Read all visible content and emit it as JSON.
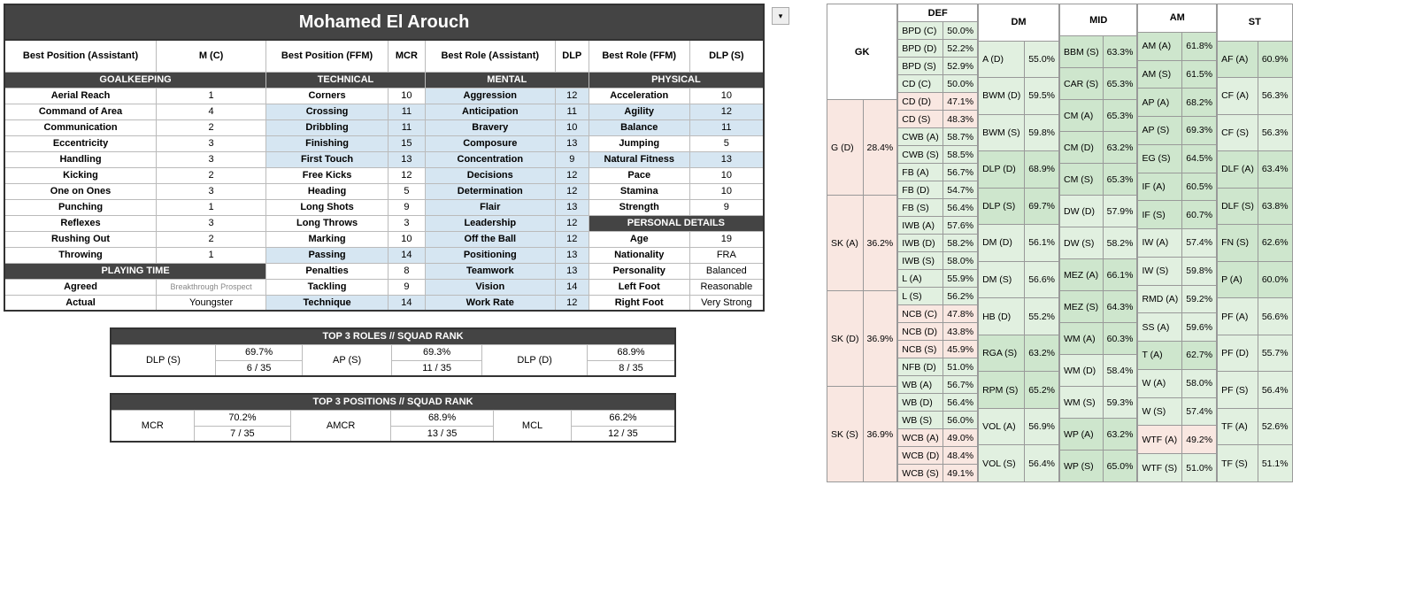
{
  "player_name": "Mohamed El Arouch",
  "best": {
    "pos_assistant": {
      "label": "Best Position (Assistant)",
      "value": "M (C)"
    },
    "pos_ffm": {
      "label": "Best Position (FFM)",
      "value": "MCR"
    },
    "role_assistant": {
      "label": "Best Role (Assistant)",
      "value": "DLP"
    },
    "role_ffm": {
      "label": "Best Role (FFM)",
      "value": "DLP (S)"
    }
  },
  "sections": {
    "goalkeeping": "GOALKEEPING",
    "technical": "TECHNICAL",
    "mental": "MENTAL",
    "physical": "PHYSICAL",
    "playing_time": "PLAYING TIME",
    "personal": "PERSONAL DETAILS"
  },
  "gk": [
    {
      "n": "Aerial Reach",
      "v": "1"
    },
    {
      "n": "Command of Area",
      "v": "4"
    },
    {
      "n": "Communication",
      "v": "2"
    },
    {
      "n": "Eccentricity",
      "v": "3"
    },
    {
      "n": "Handling",
      "v": "3"
    },
    {
      "n": "Kicking",
      "v": "2"
    },
    {
      "n": "One on Ones",
      "v": "3"
    },
    {
      "n": "Punching",
      "v": "1"
    },
    {
      "n": "Reflexes",
      "v": "3"
    },
    {
      "n": "Rushing Out",
      "v": "2"
    },
    {
      "n": "Throwing",
      "v": "1"
    }
  ],
  "tech": [
    {
      "n": "Corners",
      "v": "10"
    },
    {
      "n": "Crossing",
      "v": "11",
      "hl": 1
    },
    {
      "n": "Dribbling",
      "v": "11",
      "hl": 1
    },
    {
      "n": "Finishing",
      "v": "15",
      "hl": 1
    },
    {
      "n": "First Touch",
      "v": "13",
      "hl": 1
    },
    {
      "n": "Free Kicks",
      "v": "12"
    },
    {
      "n": "Heading",
      "v": "5"
    },
    {
      "n": "Long Shots",
      "v": "9"
    },
    {
      "n": "Long Throws",
      "v": "3"
    },
    {
      "n": "Marking",
      "v": "10"
    },
    {
      "n": "Passing",
      "v": "14",
      "hl": 1
    },
    {
      "n": "Penalties",
      "v": "8"
    },
    {
      "n": "Tackling",
      "v": "9"
    },
    {
      "n": "Technique",
      "v": "14",
      "hl": 1
    }
  ],
  "mental": [
    {
      "n": "Aggression",
      "v": "12",
      "hl": 1
    },
    {
      "n": "Anticipation",
      "v": "11",
      "hl": 1
    },
    {
      "n": "Bravery",
      "v": "10",
      "hl": 1
    },
    {
      "n": "Composure",
      "v": "13",
      "hl": 1
    },
    {
      "n": "Concentration",
      "v": "9",
      "hl": 1
    },
    {
      "n": "Decisions",
      "v": "12",
      "hl": 1
    },
    {
      "n": "Determination",
      "v": "12",
      "hl": 1
    },
    {
      "n": "Flair",
      "v": "13",
      "hl": 1
    },
    {
      "n": "Leadership",
      "v": "12",
      "hl": 1
    },
    {
      "n": "Off the Ball",
      "v": "12",
      "hl": 1
    },
    {
      "n": "Positioning",
      "v": "13",
      "hl": 1
    },
    {
      "n": "Teamwork",
      "v": "13",
      "hl": 1
    },
    {
      "n": "Vision",
      "v": "14",
      "hl": 1
    },
    {
      "n": "Work Rate",
      "v": "12",
      "hl": 1
    }
  ],
  "phys": [
    {
      "n": "Acceleration",
      "v": "10"
    },
    {
      "n": "Agility",
      "v": "12",
      "hl": 1
    },
    {
      "n": "Balance",
      "v": "11",
      "hl": 1
    },
    {
      "n": "Jumping",
      "v": "5"
    },
    {
      "n": "Natural Fitness",
      "v": "13",
      "hl": 1
    },
    {
      "n": "Pace",
      "v": "10"
    },
    {
      "n": "Stamina",
      "v": "10"
    },
    {
      "n": "Strength",
      "v": "9"
    }
  ],
  "playing_time": {
    "agreed": {
      "label": "Agreed",
      "value": "Breakthrough Prospect"
    },
    "actual": {
      "label": "Actual",
      "value": "Youngster"
    }
  },
  "personal": [
    {
      "n": "Age",
      "v": "19"
    },
    {
      "n": "Nationality",
      "v": "FRA"
    },
    {
      "n": "Personality",
      "v": "Balanced"
    },
    {
      "n": "Left Foot",
      "v": "Reasonable"
    },
    {
      "n": "Right Foot",
      "v": "Very Strong"
    }
  ],
  "top3roles": {
    "title": "TOP 3 ROLES // SQUAD RANK",
    "items": [
      {
        "role": "DLP (S)",
        "pct": "69.7%",
        "rank": "6 / 35"
      },
      {
        "role": "AP (S)",
        "pct": "69.3%",
        "rank": "11 / 35"
      },
      {
        "role": "DLP (D)",
        "pct": "68.9%",
        "rank": "8 / 35"
      }
    ]
  },
  "top3pos": {
    "title": "TOP 3 POSITIONS // SQUAD RANK",
    "items": [
      {
        "role": "MCR",
        "pct": "70.2%",
        "rank": "7 / 35"
      },
      {
        "role": "AMCR",
        "pct": "68.9%",
        "rank": "13 / 35"
      },
      {
        "role": "MCL",
        "pct": "66.2%",
        "rank": "12 / 35"
      }
    ]
  },
  "rolecols": [
    {
      "hdr": "GK",
      "rows": [
        {
          "n": "G (D)",
          "v": "28.4%",
          "c": "pale-red"
        },
        {
          "n": "SK (A)",
          "v": "36.2%",
          "c": "pale-red"
        },
        {
          "n": "SK (D)",
          "v": "36.9%",
          "c": "pale-red"
        },
        {
          "n": "SK (S)",
          "v": "36.9%",
          "c": "pale-red"
        }
      ]
    },
    {
      "hdr": "DEF",
      "rows": [
        {
          "n": "BPD (C)",
          "v": "50.0%",
          "c": "pale-green"
        },
        {
          "n": "BPD (D)",
          "v": "52.2%",
          "c": "pale-green"
        },
        {
          "n": "BPD (S)",
          "v": "52.9%",
          "c": "pale-green"
        },
        {
          "n": "CD (C)",
          "v": "50.0%",
          "c": "pale-green"
        },
        {
          "n": "CD (D)",
          "v": "47.1%",
          "c": "pale-red"
        },
        {
          "n": "CD (S)",
          "v": "48.3%",
          "c": "pale-red"
        },
        {
          "n": "CWB (A)",
          "v": "58.7%",
          "c": "pale-green"
        },
        {
          "n": "CWB (S)",
          "v": "58.5%",
          "c": "pale-green"
        },
        {
          "n": "FB (A)",
          "v": "56.7%",
          "c": "pale-green"
        },
        {
          "n": "FB (D)",
          "v": "54.7%",
          "c": "pale-green"
        },
        {
          "n": "FB (S)",
          "v": "56.4%",
          "c": "pale-green"
        },
        {
          "n": "IWB (A)",
          "v": "57.6%",
          "c": "pale-green"
        },
        {
          "n": "IWB (D)",
          "v": "58.2%",
          "c": "pale-green"
        },
        {
          "n": "IWB (S)",
          "v": "58.0%",
          "c": "pale-green"
        },
        {
          "n": "L (A)",
          "v": "55.9%",
          "c": "pale-green"
        },
        {
          "n": "L (S)",
          "v": "56.2%",
          "c": "pale-green"
        },
        {
          "n": "NCB (C)",
          "v": "47.8%",
          "c": "pale-red"
        },
        {
          "n": "NCB (D)",
          "v": "43.8%",
          "c": "pale-red"
        },
        {
          "n": "NCB (S)",
          "v": "45.9%",
          "c": "pale-red"
        },
        {
          "n": "NFB (D)",
          "v": "51.0%",
          "c": "pale-green"
        },
        {
          "n": "WB (A)",
          "v": "56.7%",
          "c": "pale-green"
        },
        {
          "n": "WB (D)",
          "v": "56.4%",
          "c": "pale-green"
        },
        {
          "n": "WB (S)",
          "v": "56.0%",
          "c": "pale-green"
        },
        {
          "n": "WCB (A)",
          "v": "49.0%",
          "c": "pale-red"
        },
        {
          "n": "WCB (D)",
          "v": "48.4%",
          "c": "pale-red"
        },
        {
          "n": "WCB (S)",
          "v": "49.1%",
          "c": "pale-red"
        }
      ]
    },
    {
      "hdr": "DM",
      "rows": [
        {
          "n": "A (D)",
          "v": "55.0%",
          "c": "pale-green"
        },
        {
          "n": "BWM (D)",
          "v": "59.5%",
          "c": "pale-green"
        },
        {
          "n": "BWM (S)",
          "v": "59.8%",
          "c": "pale-green"
        },
        {
          "n": "DLP (D)",
          "v": "68.9%",
          "c": "green"
        },
        {
          "n": "DLP (S)",
          "v": "69.7%",
          "c": "green"
        },
        {
          "n": "DM (D)",
          "v": "56.1%",
          "c": "pale-green"
        },
        {
          "n": "DM (S)",
          "v": "56.6%",
          "c": "pale-green"
        },
        {
          "n": "HB (D)",
          "v": "55.2%",
          "c": "pale-green"
        },
        {
          "n": "RGA (S)",
          "v": "63.2%",
          "c": "green"
        },
        {
          "n": "RPM (S)",
          "v": "65.2%",
          "c": "green"
        },
        {
          "n": "VOL (A)",
          "v": "56.9%",
          "c": "pale-green"
        },
        {
          "n": "VOL (S)",
          "v": "56.4%",
          "c": "pale-green"
        }
      ]
    },
    {
      "hdr": "MID",
      "rows": [
        {
          "n": "BBM (S)",
          "v": "63.3%",
          "c": "green"
        },
        {
          "n": "CAR (S)",
          "v": "65.3%",
          "c": "green"
        },
        {
          "n": "CM (A)",
          "v": "65.3%",
          "c": "green"
        },
        {
          "n": "CM (D)",
          "v": "63.2%",
          "c": "green"
        },
        {
          "n": "CM (S)",
          "v": "65.3%",
          "c": "green"
        },
        {
          "n": "DW (D)",
          "v": "57.9%",
          "c": "pale-green"
        },
        {
          "n": "DW (S)",
          "v": "58.2%",
          "c": "pale-green"
        },
        {
          "n": "MEZ (A)",
          "v": "66.1%",
          "c": "green"
        },
        {
          "n": "MEZ (S)",
          "v": "64.3%",
          "c": "green"
        },
        {
          "n": "WM (A)",
          "v": "60.3%",
          "c": "green"
        },
        {
          "n": "WM (D)",
          "v": "58.4%",
          "c": "pale-green"
        },
        {
          "n": "WM (S)",
          "v": "59.3%",
          "c": "pale-green"
        },
        {
          "n": "WP (A)",
          "v": "63.2%",
          "c": "green"
        },
        {
          "n": "WP (S)",
          "v": "65.0%",
          "c": "green"
        }
      ]
    },
    {
      "hdr": "AM",
      "rows": [
        {
          "n": "AM (A)",
          "v": "61.8%",
          "c": "green"
        },
        {
          "n": "AM (S)",
          "v": "61.5%",
          "c": "green"
        },
        {
          "n": "AP (A)",
          "v": "68.2%",
          "c": "green"
        },
        {
          "n": "AP (S)",
          "v": "69.3%",
          "c": "green"
        },
        {
          "n": "EG (S)",
          "v": "64.5%",
          "c": "green"
        },
        {
          "n": "IF (A)",
          "v": "60.5%",
          "c": "green"
        },
        {
          "n": "IF (S)",
          "v": "60.7%",
          "c": "green"
        },
        {
          "n": "IW (A)",
          "v": "57.4%",
          "c": "pale-green"
        },
        {
          "n": "IW (S)",
          "v": "59.8%",
          "c": "pale-green"
        },
        {
          "n": "RMD (A)",
          "v": "59.2%",
          "c": "pale-green"
        },
        {
          "n": "SS (A)",
          "v": "59.6%",
          "c": "pale-green"
        },
        {
          "n": "T (A)",
          "v": "62.7%",
          "c": "green"
        },
        {
          "n": "W (A)",
          "v": "58.0%",
          "c": "pale-green"
        },
        {
          "n": "W (S)",
          "v": "57.4%",
          "c": "pale-green"
        },
        {
          "n": "WTF (A)",
          "v": "49.2%",
          "c": "pale-red"
        },
        {
          "n": "WTF (S)",
          "v": "51.0%",
          "c": "pale-green"
        }
      ]
    },
    {
      "hdr": "ST",
      "rows": [
        {
          "n": "AF (A)",
          "v": "60.9%",
          "c": "green"
        },
        {
          "n": "CF (A)",
          "v": "56.3%",
          "c": "pale-green"
        },
        {
          "n": "CF (S)",
          "v": "56.3%",
          "c": "pale-green"
        },
        {
          "n": "DLF (A)",
          "v": "63.4%",
          "c": "green"
        },
        {
          "n": "DLF (S)",
          "v": "63.8%",
          "c": "green"
        },
        {
          "n": "FN (S)",
          "v": "62.6%",
          "c": "green"
        },
        {
          "n": "P (A)",
          "v": "60.0%",
          "c": "green"
        },
        {
          "n": "PF (A)",
          "v": "56.6%",
          "c": "pale-green"
        },
        {
          "n": "PF (D)",
          "v": "55.7%",
          "c": "pale-green"
        },
        {
          "n": "PF (S)",
          "v": "56.4%",
          "c": "pale-green"
        },
        {
          "n": "TF (A)",
          "v": "52.6%",
          "c": "pale-green"
        },
        {
          "n": "TF (S)",
          "v": "51.1%",
          "c": "pale-green"
        }
      ]
    }
  ]
}
